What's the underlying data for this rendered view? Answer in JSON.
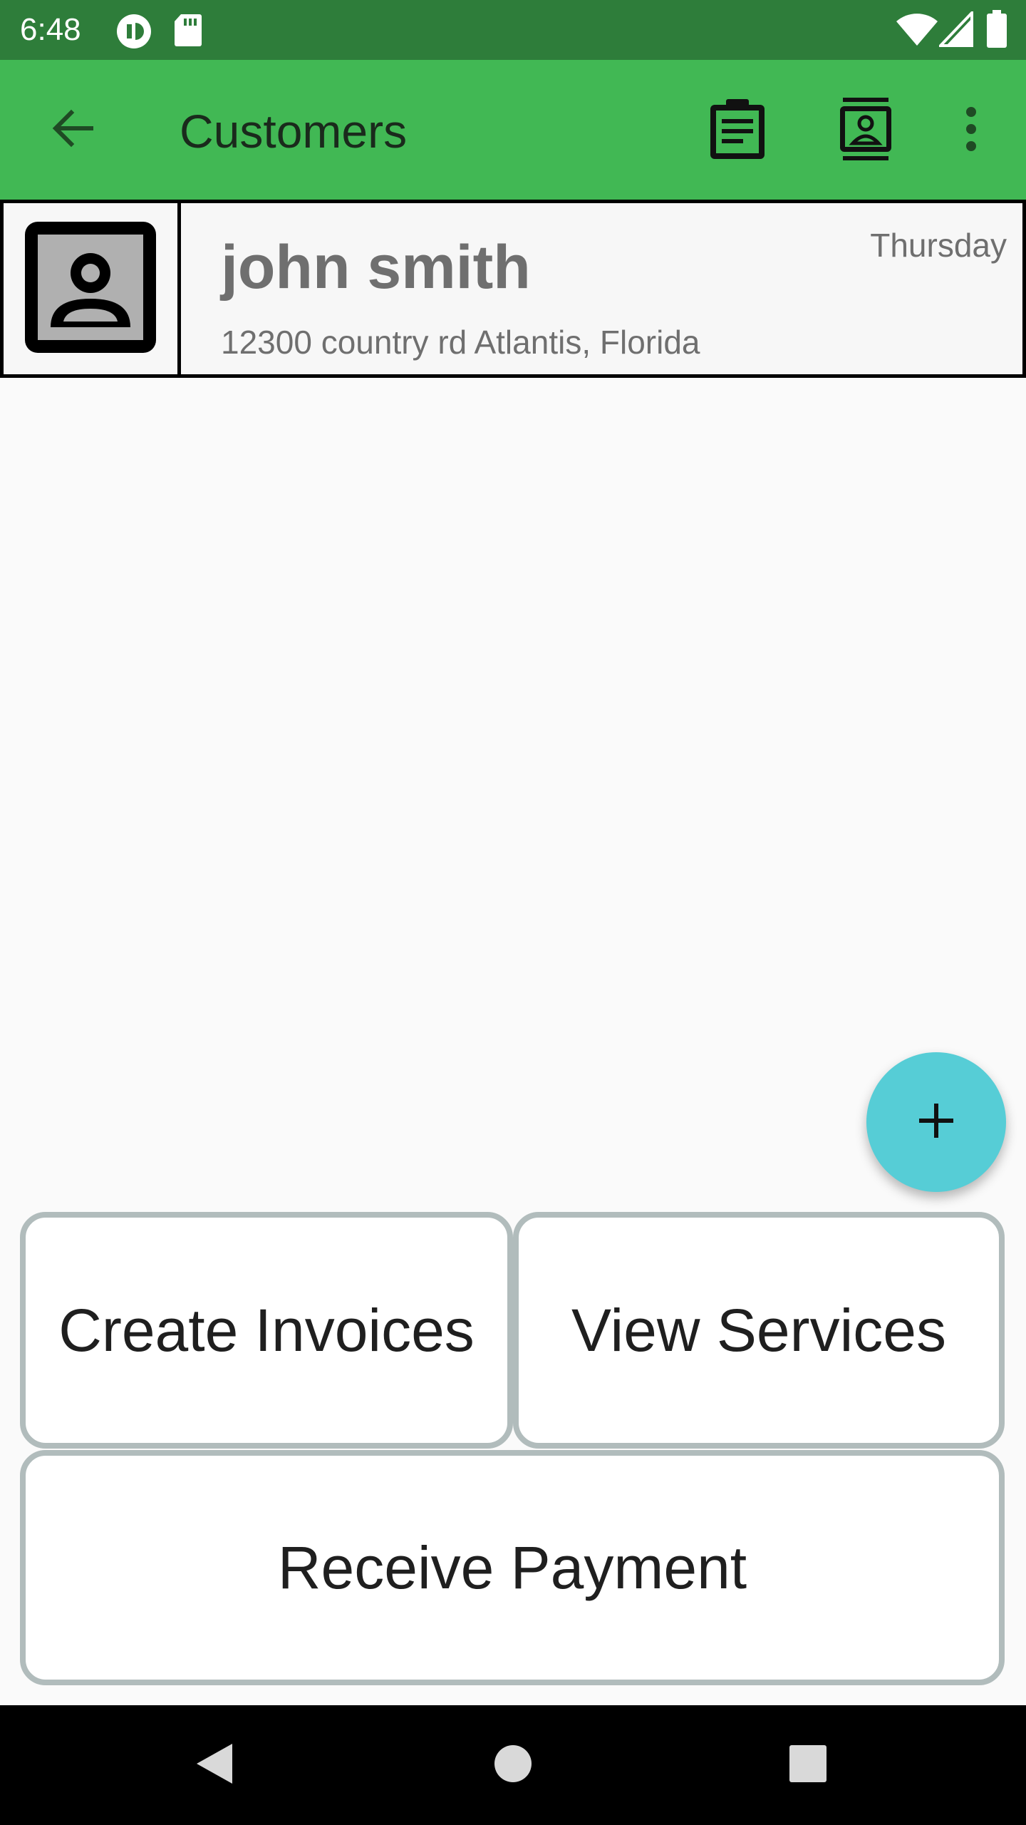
{
  "status_bar": {
    "time": "6:48",
    "icons": [
      "notification-app-icon",
      "sd-card-icon",
      "wifi-icon",
      "cellular-signal-icon",
      "battery-icon"
    ]
  },
  "app_bar": {
    "title": "Customers",
    "back_icon": "arrow-back-icon",
    "actions": [
      "clipboard-list-icon",
      "contact-card-icon",
      "more-vert-icon"
    ],
    "background": "#41b854",
    "status_background": "#2e7d3a"
  },
  "customers": [
    {
      "name": "john smith",
      "address": "12300 country rd Atlantis, Florida",
      "day": "Thursday",
      "avatar_icon": "contact-portrait-icon"
    }
  ],
  "fab": {
    "icon": "plus-icon",
    "color": "#56cdd6"
  },
  "actions": {
    "create_invoices": "Create Invoices",
    "view_services": "View Services",
    "receive_payment": "Receive Payment"
  },
  "nav_bar": {
    "icons": [
      "back-triangle-icon",
      "home-circle-icon",
      "recents-square-icon"
    ]
  }
}
